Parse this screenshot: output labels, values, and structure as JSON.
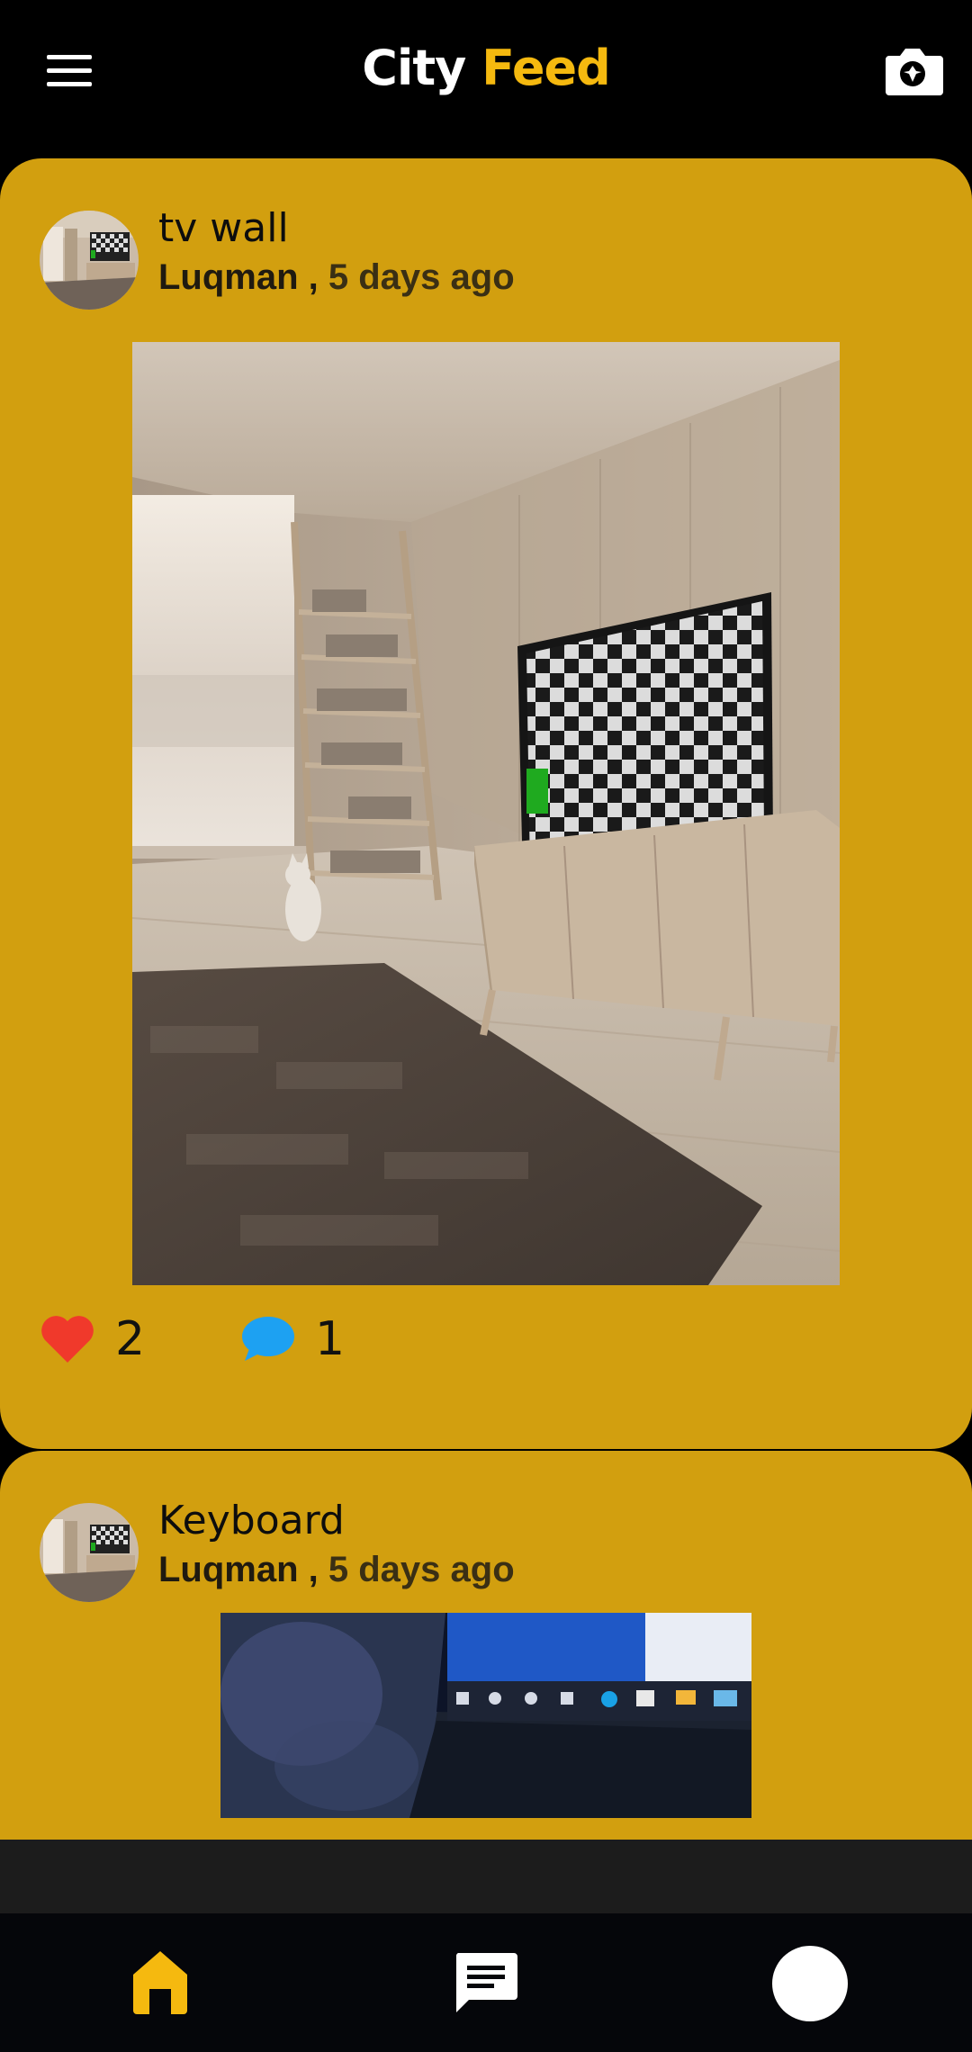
{
  "header": {
    "title_part1": "City",
    "title_part2": "Feed",
    "menu_icon": "hamburger-menu-icon",
    "camera_icon": "camera-add-icon",
    "accent_color": "#f5b90f"
  },
  "posts": [
    {
      "title": "tv wall",
      "author": "Luqman",
      "separator": " , ",
      "time": "5 days ago",
      "likes": "2",
      "comments": "1",
      "image_desc_icon": "post-photo"
    },
    {
      "title": "Keyboard",
      "author": "Luqman",
      "separator": " , ",
      "time": "5 days ago",
      "image_desc_icon": "post-photo"
    }
  ],
  "colors": {
    "card": "#d29f0f",
    "like": "#f0392b",
    "comment": "#1da1f2",
    "home_active": "#f5b90f"
  },
  "bottom_nav": {
    "items": [
      "home-icon",
      "chat-icon",
      "profile-avatar"
    ]
  }
}
